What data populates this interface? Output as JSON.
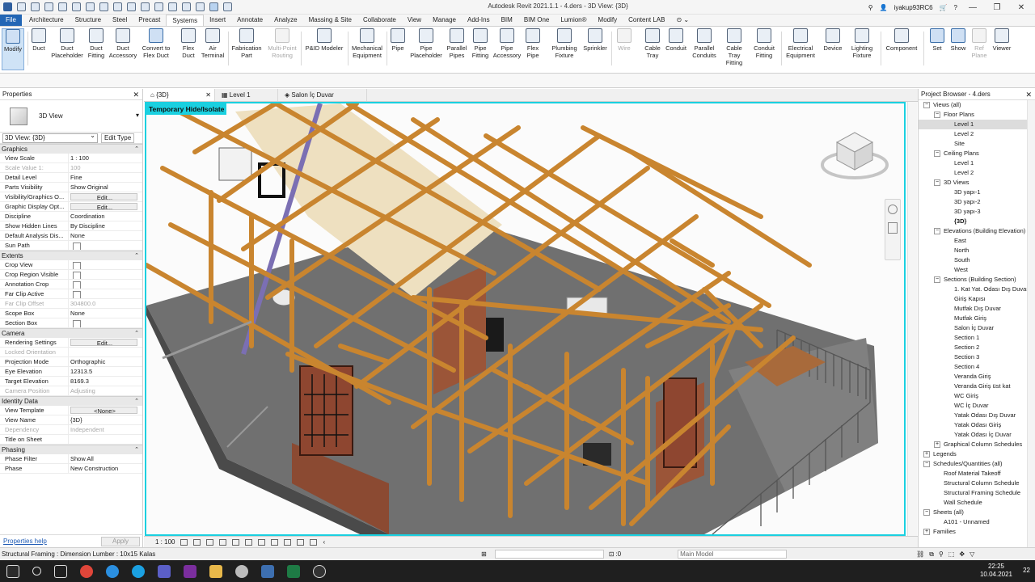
{
  "titlebar": {
    "app_title": "Autodesk Revit 2021.1.1 - 4.ders - 3D View: {3D}",
    "user": "iyakup93RC6",
    "help": "?",
    "minimize": "—",
    "maximize": "❐",
    "close": "✕"
  },
  "tabs": [
    "File",
    "Architecture",
    "Structure",
    "Steel",
    "Precast",
    "Systems",
    "Insert",
    "Annotate",
    "Analyze",
    "Massing & Site",
    "Collaborate",
    "View",
    "Manage",
    "Add-Ins",
    "BIM",
    "BIM One",
    "Lumion®",
    "Modify",
    "Content LAB"
  ],
  "ribbon": {
    "modify": "Modify",
    "duct": "Duct",
    "duct_placeholder": "Duct Placeholder",
    "duct_fitting": "Duct Fitting",
    "duct_accessory": "Duct Accessory",
    "convert_flex_duct": "Convert to Flex Duct",
    "flex_duct": "Flex Duct",
    "air_terminal": "Air Terminal",
    "fabrication_part": "Fabrication Part",
    "multipoint_routing": "Multi-Point Routing",
    "pid_modeler": "P&ID Modeler",
    "mechanical_equipment": "Mechanical Equipment",
    "pipe": "Pipe",
    "pipe_placeholder": "Pipe Placeholder",
    "parallel_pipes": "Parallel Pipes",
    "pipe_fitting": "Pipe Fitting",
    "pipe_accessory": "Pipe Accessory",
    "flex_pipe": "Flex Pipe",
    "plumbing_fixture": "Plumbing Fixture",
    "sprinkler": "Sprinkler",
    "wire": "Wire",
    "cable_tray": "Cable Tray",
    "conduit": "Conduit",
    "parallel_conduits": "Parallel Conduits",
    "cable_tray_fitting": "Cable Tray Fitting",
    "conduit_fitting": "Conduit Fitting",
    "electrical_equipment": "Electrical Equipment",
    "device": "Device",
    "lighting_fixture": "Lighting Fixture",
    "component": "Component",
    "set": "Set",
    "show": "Show",
    "ref_plane": "Ref Plane",
    "viewer": "Viewer"
  },
  "properties": {
    "title": "Properties",
    "type_name": "3D View",
    "view_selector": "3D View: {3D}",
    "edit_type": "Edit Type",
    "groups": [
      {
        "name": "Graphics",
        "rows": [
          {
            "name": "View Scale",
            "value": "1 : 100"
          },
          {
            "name": "Scale Value    1:",
            "value": "100",
            "disabled": true
          },
          {
            "name": "Detail Level",
            "value": "Fine"
          },
          {
            "name": "Parts Visibility",
            "value": "Show Original"
          },
          {
            "name": "Visibility/Graphics O...",
            "value": "Edit...",
            "button": true
          },
          {
            "name": "Graphic Display Opt...",
            "value": "Edit...",
            "button": true
          },
          {
            "name": "Discipline",
            "value": "Coordination"
          },
          {
            "name": "Show Hidden Lines",
            "value": "By Discipline"
          },
          {
            "name": "Default Analysis Dis...",
            "value": "None"
          },
          {
            "name": "Sun Path",
            "value": "",
            "checkbox": true
          }
        ]
      },
      {
        "name": "Extents",
        "rows": [
          {
            "name": "Crop View",
            "value": "",
            "checkbox": true
          },
          {
            "name": "Crop Region Visible",
            "value": "",
            "checkbox": true
          },
          {
            "name": "Annotation Crop",
            "value": "",
            "checkbox": true
          },
          {
            "name": "Far Clip Active",
            "value": "",
            "checkbox": true
          },
          {
            "name": "Far Clip Offset",
            "value": "304800.0",
            "disabled": true
          },
          {
            "name": "Scope Box",
            "value": "None"
          },
          {
            "name": "Section Box",
            "value": "",
            "checkbox": true
          }
        ]
      },
      {
        "name": "Camera",
        "rows": [
          {
            "name": "Rendering Settings",
            "value": "Edit...",
            "button": true
          },
          {
            "name": "Locked Orientation",
            "value": "",
            "disabled": true
          },
          {
            "name": "Projection Mode",
            "value": "Orthographic"
          },
          {
            "name": "Eye Elevation",
            "value": "12313.5"
          },
          {
            "name": "Target Elevation",
            "value": "8169.3"
          },
          {
            "name": "Camera Position",
            "value": "Adjusting",
            "disabled": true
          }
        ]
      },
      {
        "name": "Identity Data",
        "rows": [
          {
            "name": "View Template",
            "value": "<None>",
            "button": true
          },
          {
            "name": "View Name",
            "value": "{3D}"
          },
          {
            "name": "Dependency",
            "value": "Independent",
            "disabled": true
          },
          {
            "name": "Title on Sheet",
            "value": ""
          }
        ]
      },
      {
        "name": "Phasing",
        "rows": [
          {
            "name": "Phase Filter",
            "value": "Show All"
          },
          {
            "name": "Phase",
            "value": "New Construction"
          }
        ]
      }
    ],
    "help_link": "Properties help",
    "apply": "Apply"
  },
  "view_tabs": [
    {
      "label": "{3D}",
      "active": true
    },
    {
      "label": "Level 1",
      "active": false
    },
    {
      "label": "Salon İç Duvar",
      "active": false
    }
  ],
  "viewport": {
    "temp_hide_label": "Temporary Hide/Isolate",
    "scale": "1 : 100"
  },
  "browser": {
    "title": "Project Browser - 4.ders",
    "tree": [
      {
        "label": "Views (all)",
        "level": 0,
        "toggle": "−"
      },
      {
        "label": "Floor Plans",
        "level": 1,
        "toggle": "−"
      },
      {
        "label": "Level 1",
        "level": 2,
        "selected": true
      },
      {
        "label": "Level 2",
        "level": 2
      },
      {
        "label": "Site",
        "level": 2
      },
      {
        "label": "Ceiling Plans",
        "level": 1,
        "toggle": "−"
      },
      {
        "label": "Level 1",
        "level": 2
      },
      {
        "label": "Level 2",
        "level": 2
      },
      {
        "label": "3D Views",
        "level": 1,
        "toggle": "−"
      },
      {
        "label": "3D yapı-1",
        "level": 2
      },
      {
        "label": "3D yapı-2",
        "level": 2
      },
      {
        "label": "3D yapı-3",
        "level": 2
      },
      {
        "label": "{3D}",
        "level": 2,
        "bold": true
      },
      {
        "label": "Elevations (Building Elevation)",
        "level": 1,
        "toggle": "−"
      },
      {
        "label": "East",
        "level": 2
      },
      {
        "label": "North",
        "level": 2
      },
      {
        "label": "South",
        "level": 2
      },
      {
        "label": "West",
        "level": 2
      },
      {
        "label": "Sections (Building Section)",
        "level": 1,
        "toggle": "−"
      },
      {
        "label": "1. Kat Yat. Odası Dış Duvar",
        "level": 2
      },
      {
        "label": "Giriş Kapısı",
        "level": 2
      },
      {
        "label": "Mutfak Dış Duvar",
        "level": 2
      },
      {
        "label": "Mutfak Giriş",
        "level": 2
      },
      {
        "label": "Salon İç Duvar",
        "level": 2
      },
      {
        "label": "Section 1",
        "level": 2
      },
      {
        "label": "Section 2",
        "level": 2
      },
      {
        "label": "Section 3",
        "level": 2
      },
      {
        "label": "Section 4",
        "level": 2
      },
      {
        "label": "Veranda Giriş",
        "level": 2
      },
      {
        "label": "Veranda Giriş üst kat",
        "level": 2
      },
      {
        "label": "WC Giriş",
        "level": 2
      },
      {
        "label": "WC İç Duvar",
        "level": 2
      },
      {
        "label": "Yatak Odası Dış Duvar",
        "level": 2
      },
      {
        "label": "Yatak Odası Giriş",
        "level": 2
      },
      {
        "label": "Yatak Odası İç Duvar",
        "level": 2
      },
      {
        "label": "Graphical Column Schedules",
        "level": 1,
        "toggle": "+"
      },
      {
        "label": "Legends",
        "level": 0,
        "toggle": "+"
      },
      {
        "label": "Schedules/Quantities (all)",
        "level": 0,
        "toggle": "−"
      },
      {
        "label": "Roof Material Takeoff",
        "level": 1
      },
      {
        "label": "Structural Column Schedule",
        "level": 1
      },
      {
        "label": "Structural Framing Schedule",
        "level": 1
      },
      {
        "label": "Wall Schedule",
        "level": 1
      },
      {
        "label": "Sheets (all)",
        "level": 0,
        "toggle": "−"
      },
      {
        "label": "A101 - Unnamed",
        "level": 1
      },
      {
        "label": "Families",
        "level": 0,
        "toggle": "+"
      }
    ]
  },
  "statusbar": {
    "text": "Structural Framing : Dimension Lumber : 10x15 Kalas",
    "selection_count": ":0",
    "model": "Main Model"
  },
  "taskbar": {
    "time": "22:25",
    "date": "10.04.2021",
    "notifications": "22"
  },
  "colors": {
    "accent": "#2366b5",
    "temp_hide": "#1ad0e0",
    "timber": "#c9852f",
    "floor": "#6e6e6e"
  }
}
